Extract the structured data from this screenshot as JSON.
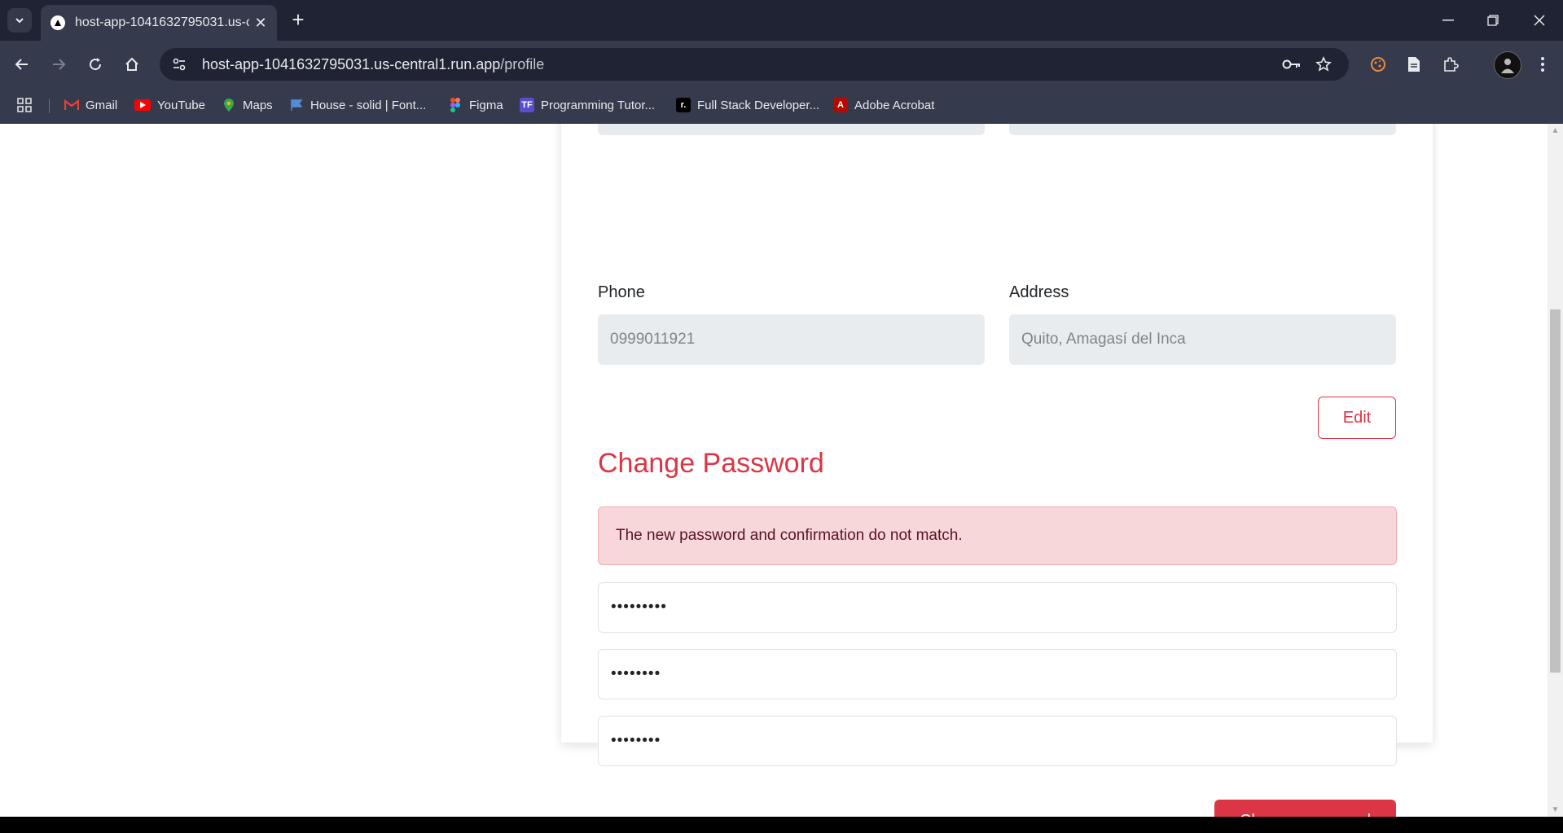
{
  "browser": {
    "tab_title": "host-app-1041632795031.us-central1.run.app/profile",
    "tab_title_visible": "host-app-1041632795031.us-ce",
    "url_host": "host-app-1041632795031.us-central1.run.app",
    "url_path": "/profile",
    "bookmarks": [
      {
        "label": "Gmail",
        "icon": "gmail-icon",
        "color": "#ea4335"
      },
      {
        "label": "YouTube",
        "icon": "youtube-icon",
        "color": "#ff0000"
      },
      {
        "label": "Maps",
        "icon": "maps-icon",
        "color": "#34a853"
      },
      {
        "label": "House - solid | Font...",
        "icon": "fontawesome-icon",
        "color": "#538dd7"
      },
      {
        "label": "Figma",
        "icon": "figma-icon",
        "color": "#f24e1e"
      },
      {
        "label": "Programming Tutor...",
        "icon": "programming-icon",
        "color": "#5a4fcf"
      },
      {
        "label": "Full Stack Developer...",
        "icon": "fullstack-icon",
        "color": "#000000"
      },
      {
        "label": "Adobe Acrobat",
        "icon": "acrobat-icon",
        "color": "#b30b00"
      }
    ]
  },
  "profile": {
    "phone_label": "Phone",
    "phone_value": "0999011921",
    "address_label": "Address",
    "address_value": "Quito, Amagasí del Inca",
    "edit_label": "Edit"
  },
  "change_password": {
    "title": "Change Password",
    "error": "The new password and confirmation do not match.",
    "current_masked": "•••••••••",
    "new_masked": "••••••••",
    "confirm_masked": "••••••••",
    "submit_label": "Change password"
  },
  "colors": {
    "accent": "#dc3545",
    "alert_bg": "#f8d7da",
    "chrome_dark": "#1f2333",
    "chrome_mid": "#353a4d"
  }
}
